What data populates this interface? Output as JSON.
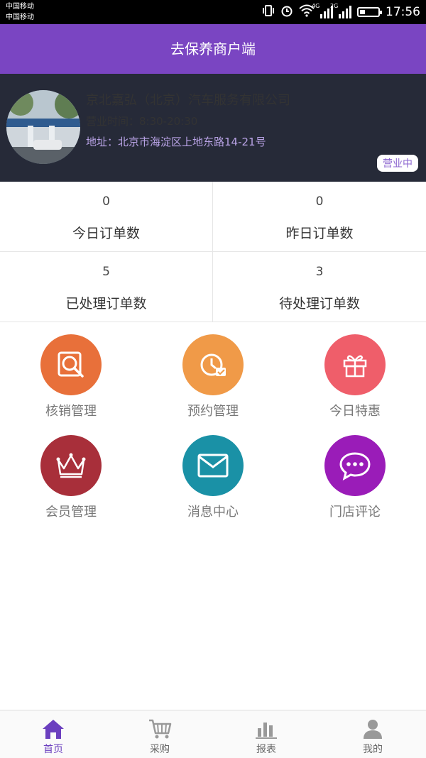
{
  "status_bar": {
    "carrier1": "中国移动",
    "carrier2": "中国移动",
    "net1": "4G",
    "net2": "2G",
    "time": "17:56",
    "battery_level": 0.3
  },
  "header": {
    "title": "去保养商户端"
  },
  "shop": {
    "name": "京北嘉弘（北京）汽车服务有限公司",
    "hours": "营业时间：8:30-20:30",
    "address": "地址：北京市海淀区上地东路14-21号",
    "status_badge": "营业中"
  },
  "stats": [
    {
      "value": "0",
      "label": "今日订单数"
    },
    {
      "value": "0",
      "label": "昨日订单数"
    },
    {
      "value": "5",
      "label": "已处理订单数"
    },
    {
      "value": "3",
      "label": "待处理订单数"
    }
  ],
  "features": [
    {
      "label": "核销管理",
      "icon": "verify-search-icon",
      "color": "#e8703a"
    },
    {
      "label": "预约管理",
      "icon": "appointment-clock-icon",
      "color": "#f09a48"
    },
    {
      "label": "今日特惠",
      "icon": "gift-icon",
      "color": "#ef5e6a"
    },
    {
      "label": "会员管理",
      "icon": "crown-icon",
      "color": "#a82f3a"
    },
    {
      "label": "消息中心",
      "icon": "mail-icon",
      "color": "#1a91a6"
    },
    {
      "label": "门店评论",
      "icon": "chat-bubble-icon",
      "color": "#9a1cb8"
    }
  ],
  "tabs": [
    {
      "label": "首页",
      "icon": "home-icon",
      "active": true
    },
    {
      "label": "采购",
      "icon": "cart-icon",
      "active": false
    },
    {
      "label": "报表",
      "icon": "bar-chart-icon",
      "active": false
    },
    {
      "label": "我的",
      "icon": "user-icon",
      "active": false
    }
  ],
  "colors": {
    "brand": "#7a45c2",
    "active_tab": "#6b3fbf"
  }
}
